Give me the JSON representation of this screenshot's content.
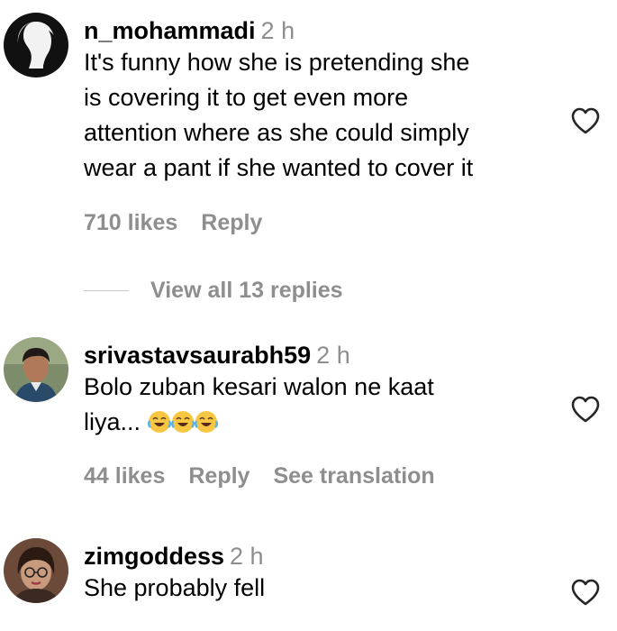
{
  "comments": [
    {
      "username": "n_mohammadi",
      "time": "2 h",
      "lines": [
        "It's funny how she is pretending she",
        "is covering it to get even more",
        "attention where as she could simply",
        "wear a pant if she wanted to cover it"
      ],
      "likes": "710 likes",
      "reply": "Reply",
      "view_replies": "View all 13 replies"
    },
    {
      "username": "srivastavsaurabh59",
      "time": "2 h",
      "lines": [
        "Bolo zuban kesari walon ne kaat",
        "liya..."
      ],
      "emojis": [
        "face-with-tears-of-joy",
        "face-with-tears-of-joy",
        "face-with-tears-of-joy"
      ],
      "likes": "44 likes",
      "reply": "Reply",
      "see_translation": "See translation"
    },
    {
      "username": "zimgoddess",
      "time": "2 h",
      "lines": [
        "She probably fell"
      ]
    }
  ],
  "icons": {
    "like": "heart-outline-icon"
  },
  "colors": {
    "text": "#000000",
    "muted": "#8e8e8e",
    "divider": "#c7c7c7"
  }
}
